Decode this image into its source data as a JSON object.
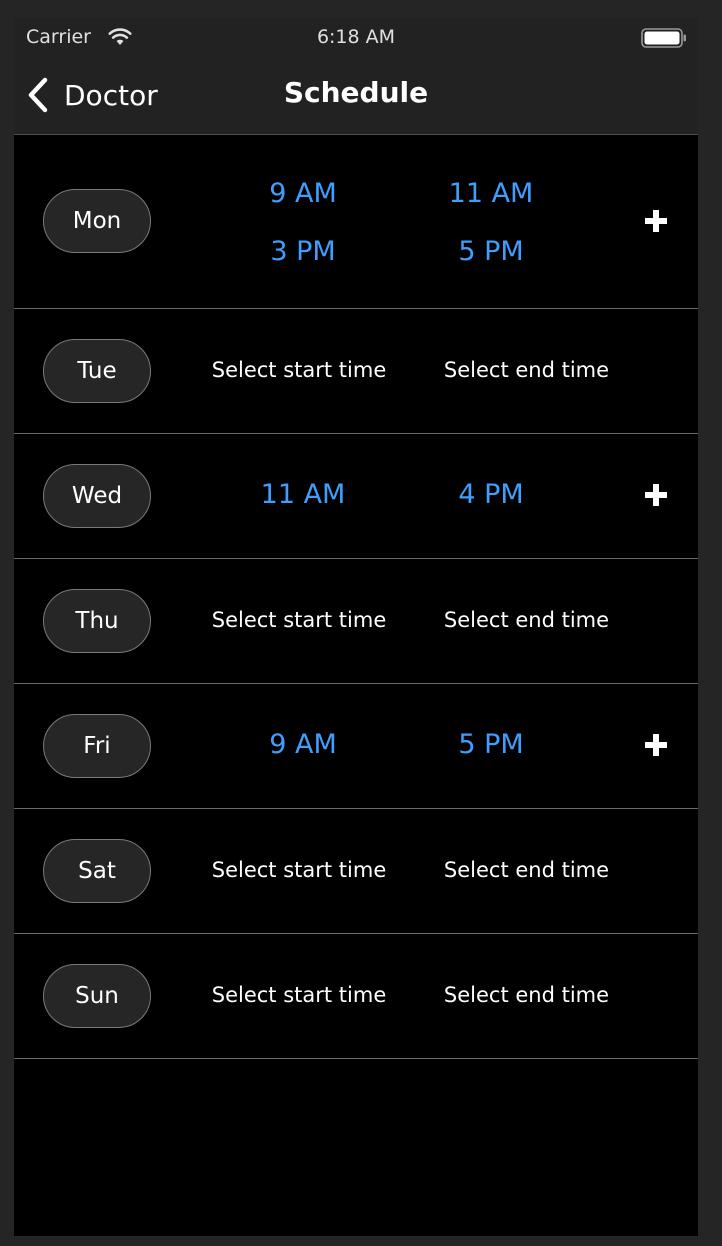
{
  "status_bar": {
    "carrier": "Carrier",
    "time": "6:18 AM"
  },
  "nav": {
    "back_label": "Doctor",
    "title": "Schedule"
  },
  "days": [
    {
      "day": "Mon",
      "slots": [
        {
          "start": "9 AM",
          "end": "11 AM"
        },
        {
          "start": "3 PM",
          "end": "5 PM"
        }
      ],
      "can_add": true
    },
    {
      "day": "Tue",
      "placeholder_start": "Select start time",
      "placeholder_end": "Select end time"
    },
    {
      "day": "Wed",
      "slots": [
        {
          "start": "11 AM",
          "end": "4 PM"
        }
      ],
      "can_add": true
    },
    {
      "day": "Thu",
      "placeholder_start": "Select start time",
      "placeholder_end": "Select end time"
    },
    {
      "day": "Fri",
      "slots": [
        {
          "start": "9 AM",
          "end": "5 PM"
        }
      ],
      "can_add": true
    },
    {
      "day": "Sat",
      "placeholder_start": "Select start time",
      "placeholder_end": "Select end time"
    },
    {
      "day": "Sun",
      "placeholder_start": "Select start time",
      "placeholder_end": "Select end time"
    }
  ],
  "colors": {
    "accent": "#3f9fff",
    "background": "#000000",
    "bar": "#222222",
    "separator": "#6b6b6b"
  },
  "icons": {
    "back": "chevron-left-icon",
    "add": "plus-icon",
    "wifi": "wifi-icon",
    "battery": "battery-icon"
  }
}
